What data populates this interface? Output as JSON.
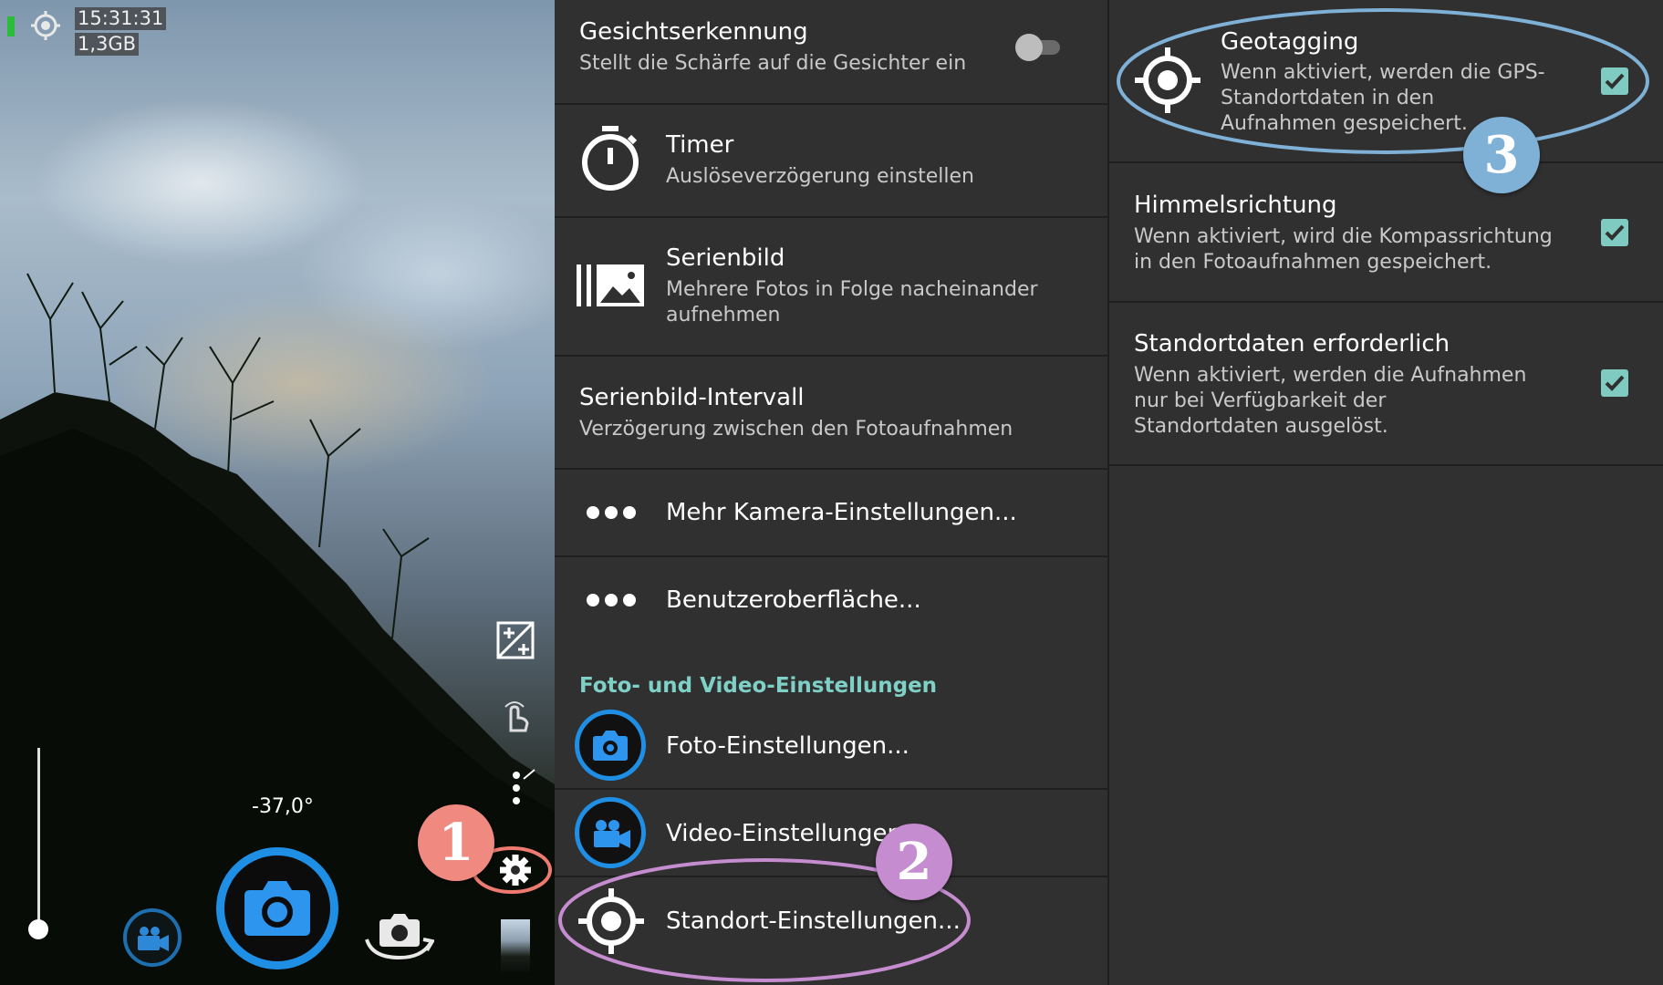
{
  "camera": {
    "status_time": "15:31:31",
    "status_storage": "1,3GB",
    "angle": "-37,0°",
    "icons": [
      "location-target-icon",
      "exposure-icon",
      "touch-icon",
      "more-dots-icon",
      "gear-icon",
      "video-camera-icon",
      "camera-icon",
      "switch-camera-icon",
      "gallery-thumbnail"
    ]
  },
  "menu": {
    "items": [
      {
        "title": "Gesichtserkennung",
        "subtitle": "Stellt die Schärfe auf die Gesichter ein"
      },
      {
        "title": "Timer",
        "subtitle": "Auslöseverzögerung einstellen"
      },
      {
        "title": "Serienbild",
        "subtitle": "Mehrere Fotos in Folge nacheinander aufnehmen"
      },
      {
        "title": "Serienbild-Intervall",
        "subtitle": "Verzögerung zwischen den Fotoaufnahmen"
      },
      {
        "title": "Mehr Kamera-Einstellungen..."
      },
      {
        "title": "Benutzeroberfläche..."
      }
    ],
    "section_header": "Foto- und Video-Einstellungen",
    "section_items": [
      {
        "title": "Foto-Einstellungen..."
      },
      {
        "title": "Video-Einstellungen..."
      },
      {
        "title": "Standort-Einstellungen..."
      }
    ]
  },
  "location": {
    "items": [
      {
        "title": "Geotagging",
        "subtitle": "Wenn aktiviert, werden die GPS-Standortdaten in den Aufnahmen gespeichert.",
        "checked": true
      },
      {
        "title": "Himmelsrichtung",
        "subtitle": "Wenn aktiviert, wird die Kompassrichtung in den Fotoaufnahmen gespeichert.",
        "checked": true
      },
      {
        "title": "Standortdaten erforderlich",
        "subtitle": "Wenn aktiviert, werden die Aufnahmen nur bei Verfügbarkeit der Standortdaten ausgelöst.",
        "checked": true
      }
    ]
  },
  "annotations": {
    "step1": "1",
    "step2": "2",
    "step3": "3",
    "colors": {
      "step1": "#f08a80",
      "step2": "#c58ccf",
      "step3": "#7fb0d6"
    }
  },
  "colors": {
    "accent_teal": "#7fd0c6",
    "shutter_blue": "#1f8fe6",
    "panel_bg": "#303030"
  }
}
